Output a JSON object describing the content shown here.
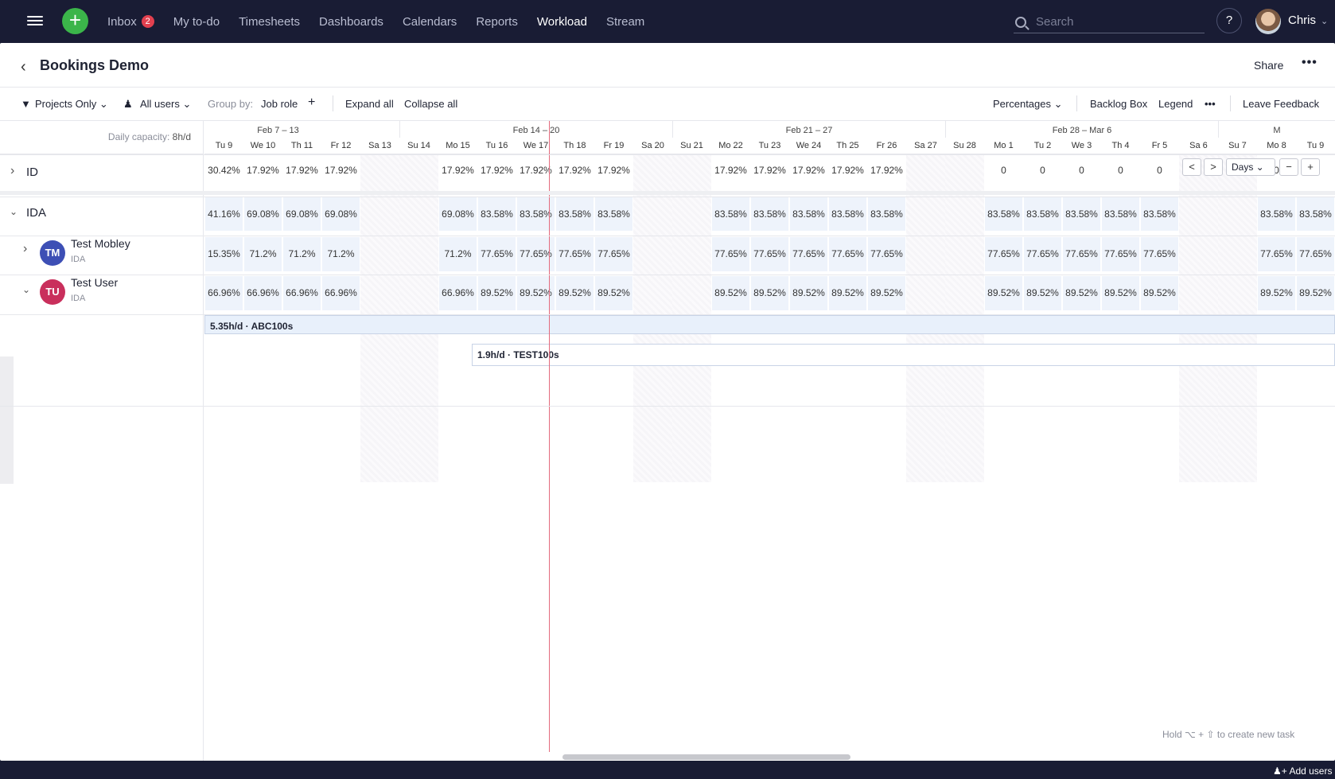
{
  "nav": {
    "items": [
      {
        "label": "Inbox",
        "badge": "2"
      },
      {
        "label": "My to-do"
      },
      {
        "label": "Timesheets"
      },
      {
        "label": "Dashboards"
      },
      {
        "label": "Calendars"
      },
      {
        "label": "Reports"
      },
      {
        "label": "Workload",
        "active": true
      },
      {
        "label": "Stream"
      }
    ],
    "search_placeholder": "Search",
    "help": "?",
    "user": "Chris"
  },
  "header": {
    "title": "Bookings Demo",
    "share": "Share",
    "more": "•••"
  },
  "toolbar": {
    "filter": "Projects Only",
    "users": "All users",
    "group_by_label": "Group by:",
    "group_by_value": "Job role",
    "expand": "Expand all",
    "collapse": "Collapse all",
    "mode": "Percentages",
    "backlog": "Backlog Box",
    "legend": "Legend",
    "feedback": "Leave Feedback"
  },
  "capacity": {
    "label": "Daily capacity:",
    "value": "8h/d"
  },
  "weeks": [
    "Feb 7 – 13",
    "Feb 14 – 20",
    "Feb 21 – 27",
    "Feb 28 – Mar 6",
    "M"
  ],
  "days": [
    "Tu 9",
    "We 10",
    "Th 11",
    "Fr 12",
    "Sa 13",
    "Su 14",
    "Mo 15",
    "Tu 16",
    "We 17",
    "Th 18",
    "Fr 19",
    "Sa 20",
    "Su 21",
    "Mo 22",
    "Tu 23",
    "We 24",
    "Th 25",
    "Fr 26",
    "Sa 27",
    "Su 28",
    "Mo 1",
    "Tu 2",
    "We 3",
    "Th 4",
    "Fr 5",
    "Sa 6",
    "Su 7",
    "Mo 8",
    "Tu 9"
  ],
  "rows": [
    {
      "name": "ID",
      "values": [
        "30.42%",
        "17.92%",
        "17.92%",
        "17.92%",
        "",
        "",
        "17.92%",
        "17.92%",
        "17.92%",
        "17.92%",
        "17.92%",
        "",
        "",
        "17.92%",
        "17.92%",
        "17.92%",
        "17.92%",
        "17.92%",
        "",
        "",
        "0",
        "0",
        "0",
        "0",
        "0",
        "",
        "",
        "0",
        ""
      ]
    },
    {
      "name": "IDA",
      "values": [
        "41.16%",
        "69.08%",
        "69.08%",
        "69.08%",
        "",
        "",
        "69.08%",
        "83.58%",
        "83.58%",
        "83.58%",
        "83.58%",
        "",
        "",
        "83.58%",
        "83.58%",
        "83.58%",
        "83.58%",
        "83.58%",
        "",
        "",
        "83.58%",
        "83.58%",
        "83.58%",
        "83.58%",
        "83.58%",
        "",
        "",
        "83.58%",
        "83.58%"
      ]
    },
    {
      "name": "Test Mobley",
      "role": "IDA",
      "initials": "TM",
      "color": "#3d4fb5",
      "values": [
        "15.35%",
        "71.2%",
        "71.2%",
        "71.2%",
        "",
        "",
        "71.2%",
        "77.65%",
        "77.65%",
        "77.65%",
        "77.65%",
        "",
        "",
        "77.65%",
        "77.65%",
        "77.65%",
        "77.65%",
        "77.65%",
        "",
        "",
        "77.65%",
        "77.65%",
        "77.65%",
        "77.65%",
        "77.65%",
        "",
        "",
        "77.65%",
        "77.65%"
      ]
    },
    {
      "name": "Test User",
      "role": "IDA",
      "initials": "TU",
      "color": "#c92f5c",
      "values": [
        "66.96%",
        "66.96%",
        "66.96%",
        "66.96%",
        "",
        "",
        "66.96%",
        "89.52%",
        "89.52%",
        "89.52%",
        "89.52%",
        "",
        "",
        "89.52%",
        "89.52%",
        "89.52%",
        "89.52%",
        "89.52%",
        "",
        "",
        "89.52%",
        "89.52%",
        "89.52%",
        "89.52%",
        "89.52%",
        "",
        "",
        "89.52%",
        "89.52%"
      ]
    }
  ],
  "bookings": [
    {
      "label": "5.35h/d · ABC100s"
    },
    {
      "label": "1.9h/d · TEST100s"
    }
  ],
  "controls": {
    "period": "Days",
    "prev": "<",
    "next": ">",
    "minus": "−",
    "plus": "+"
  },
  "hint": "Hold ⌥ + ⇧ to create new task",
  "footer": {
    "add_users": "Add users"
  },
  "colors": {
    "accent_green": "#3bb54a",
    "topbar": "#191c34",
    "today_line": "#e36b7d",
    "badge": "#e2404f"
  }
}
